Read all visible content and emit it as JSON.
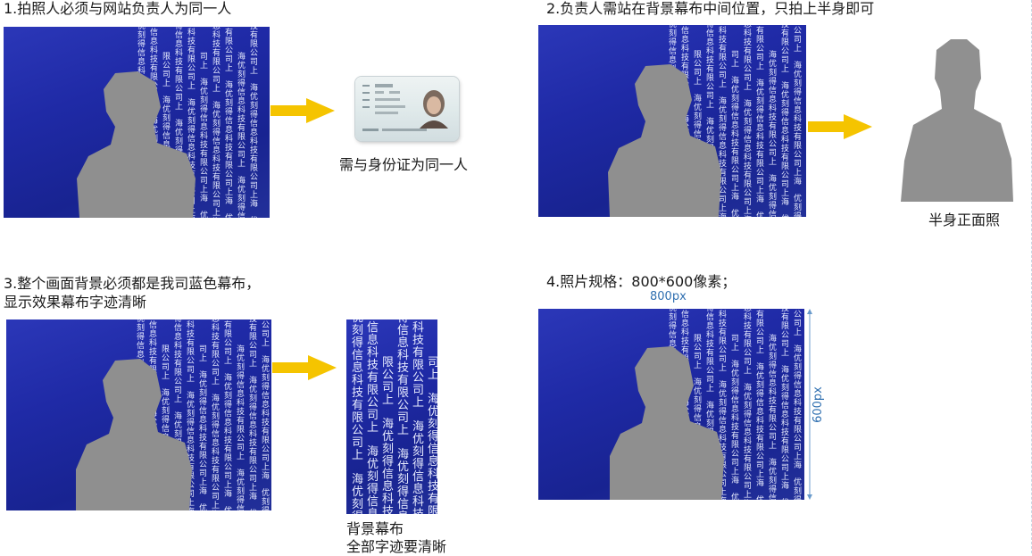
{
  "steps": [
    {
      "heading": "1.拍照人必须与网站负责人为同一人",
      "caption": "需与身份证为同一人"
    },
    {
      "heading": "2.负责人需站在背景幕布中间位置，只拍上半身即可",
      "caption": "半身正面照"
    },
    {
      "heading_line1": "3.整个画面背景必须都是我司蓝色幕布，",
      "heading_line2": "显示效果幕布字迹清晰",
      "caption_line1": "背景幕布",
      "caption_line2": "全部字迹要清晰"
    },
    {
      "heading": "4.照片规格：800*600像素；",
      "width_label": "800px",
      "height_label": "600px"
    }
  ],
  "backdrop_text": "上海优刻得信息科技有限公司",
  "colors": {
    "backdrop_blue": "#1f2aa6",
    "arrow_yellow": "#f5c400",
    "silhouette_gray": "#8f8f8f",
    "dimension_blue": "#2f6fb0"
  }
}
